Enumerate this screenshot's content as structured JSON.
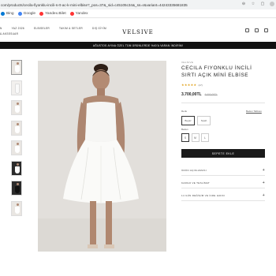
{
  "browser": {
    "url": "com/products/cecila-fiyonklu-incili-s-rt-ac-k-mini-elbise?_pos=37&_sid=c45105c34&_ss=r&variant=44243335681835",
    "bookmarks": [
      {
        "label": "Bing",
        "icon": "bing-icon",
        "color": "#0078d4"
      },
      {
        "label": "Google",
        "icon": "google-icon",
        "color": "#4285f4"
      },
      {
        "label": "Yandex.Bilet",
        "icon": "yandex-bilet-icon",
        "color": "#ff3333"
      },
      {
        "label": "Yandex",
        "icon": "yandex-icon",
        "color": "#ff3333"
      }
    ]
  },
  "header": {
    "logo": "VELSIVE",
    "nav": [
      "N",
      "YAZ 2026",
      "ELBISELER",
      "TAKIM & SETLER",
      "DIŞ GİYİM"
    ],
    "subnav": "& AKSESUAR",
    "promo": "AĞUSTOS AYINA ÖZEL TÜM ÜRÜNLERDE %40'A VARAN İNDİRİM!"
  },
  "product": {
    "brand": "VELSIVE",
    "title": "CECILA FIYONKLU İNCİLİ SIRTI AÇIK MİNİ ELBİSE",
    "rating_text": "(17)",
    "price": "3.700,00TL",
    "old_price": "6.000,00TL",
    "color_label": "Renk",
    "size_chart": "Beden Tablosu",
    "colors": [
      "Beyaz",
      "Siyah"
    ],
    "size_label": "Beden",
    "sizes": [
      "S",
      "M",
      "L"
    ],
    "add_to_cart": "SEPETE EKLE",
    "accordions": [
      "ÜRÜN AÇIKLAMASI",
      "KARGO VE TESLİMAT",
      "14 GÜN DEĞİŞİM VE İADE HAKKI"
    ]
  },
  "colors": {
    "accent": "#1a1a1a",
    "promo_bg": "#111111",
    "star": "#e0a11b"
  }
}
